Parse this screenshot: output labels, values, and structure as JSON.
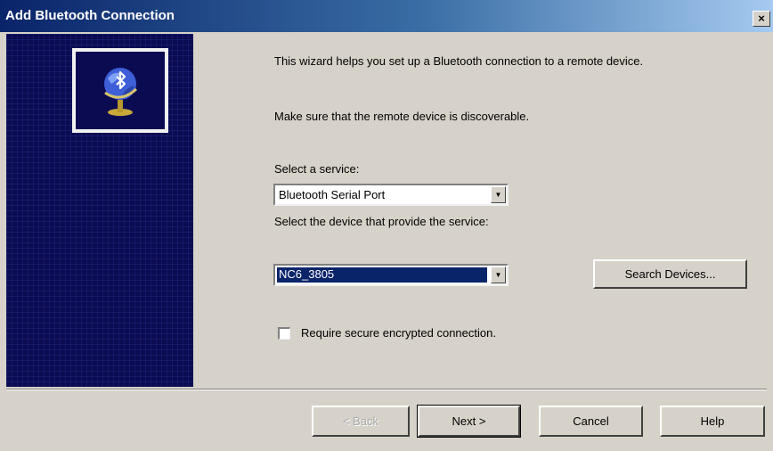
{
  "window": {
    "title": "Add Bluetooth Connection",
    "close_glyph": "×"
  },
  "side_panel": {
    "logo_icon": "bluetooth-globe-icon",
    "background_color": "#0b0b52"
  },
  "content": {
    "intro": "This wizard helps you set up a Bluetooth connection to a remote device.",
    "discoverable_note": "Make sure that the remote device is discoverable.",
    "service_label": "Select a service:",
    "service_value": "Bluetooth Serial Port",
    "device_label": "Select the device that provide the service:",
    "device_value": "NC6_3805",
    "search_devices_label": "Search Devices...",
    "secure_checkbox_label": "Require secure encrypted connection.",
    "secure_checked": false
  },
  "footer": {
    "back_label": "< Back",
    "next_label": "Next >",
    "cancel_label": "Cancel",
    "help_label": "Help"
  },
  "colors": {
    "dialog_face": "#d6d2c9",
    "title_active": "#0a246a",
    "selection": "#0a246a"
  }
}
